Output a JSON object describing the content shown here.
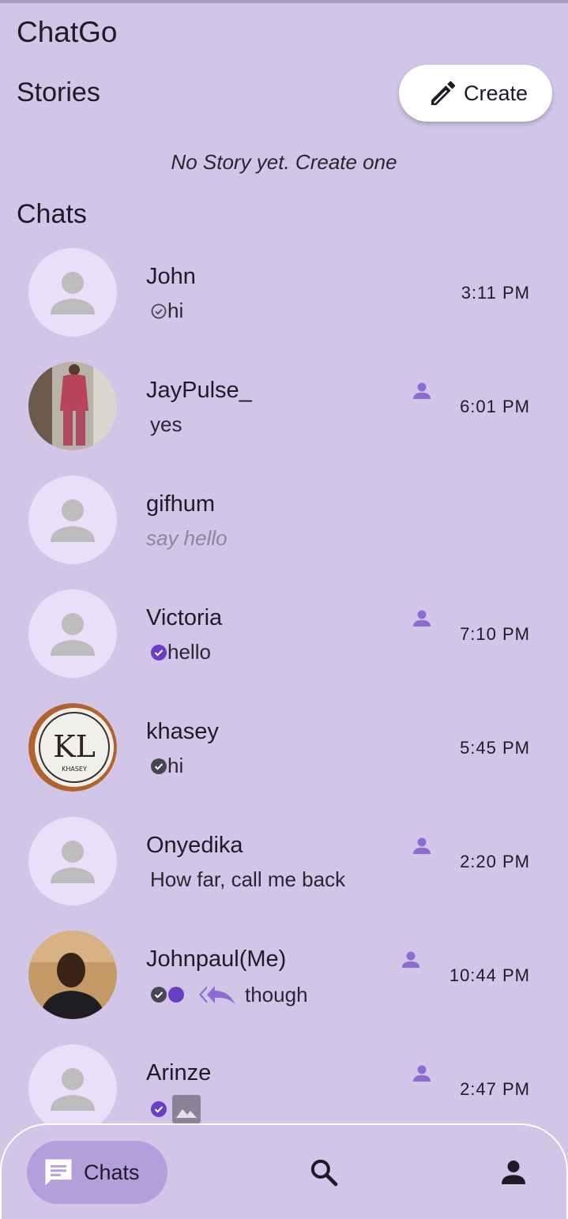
{
  "app": {
    "title": "ChatGo"
  },
  "stories": {
    "title": "Stories",
    "create_label": "Create",
    "empty_text": "No Story yet. Create one"
  },
  "chats": {
    "title": "Chats",
    "items": [
      {
        "name": "John",
        "message": "hi",
        "time": "3:11 PM"
      },
      {
        "name": "JayPulse_",
        "message": "yes",
        "time": "6:01 PM"
      },
      {
        "name": "gifhum",
        "message": "say hello",
        "time": ""
      },
      {
        "name": "Victoria",
        "message": "hello",
        "time": "7:10 PM"
      },
      {
        "name": "khasey",
        "message": "hi",
        "time": "5:45 PM",
        "avatar_text": "KHASEY"
      },
      {
        "name": "Onyedika",
        "message": "How far, call me back",
        "time": "2:20 PM"
      },
      {
        "name": "Johnpaul(Me)",
        "message": "though",
        "time": "10:44 PM"
      },
      {
        "name": "Arinze",
        "message": "",
        "time": "2:47 PM"
      }
    ]
  },
  "nav": {
    "chats_label": "Chats"
  },
  "colors": {
    "background": "#d2c6e8",
    "accent": "#6b3fc4",
    "nav_active": "#b29fdb",
    "avatar_bg": "#eadff8"
  },
  "icons": [
    "pencil-icon",
    "person-icon",
    "contact-icon",
    "check-circle-outline-icon",
    "check-circle-filled-icon",
    "reply-all-icon",
    "image-icon",
    "chat-icon",
    "search-icon",
    "profile-icon"
  ]
}
